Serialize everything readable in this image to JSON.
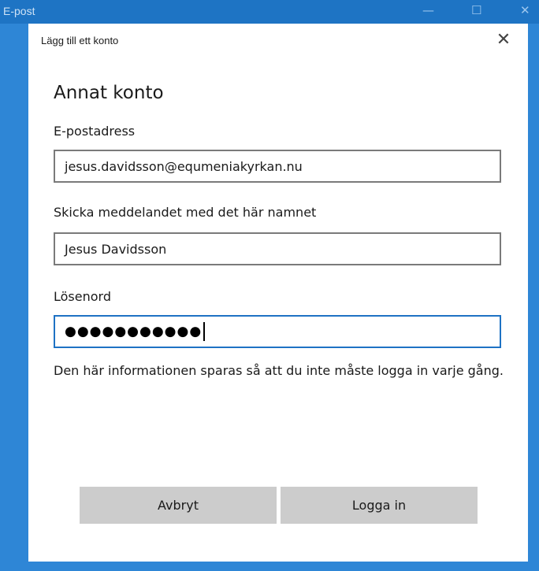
{
  "background_window": {
    "title": "E-post",
    "controls": {
      "minimize": "—",
      "maximize": "☐",
      "close": "✕"
    }
  },
  "dialog": {
    "title": "Lägg till ett konto",
    "close_icon": "✕",
    "heading": "Annat konto",
    "email": {
      "label": "E-postadress",
      "value": "jesus.davidsson@equmeniakyrkan.nu"
    },
    "name": {
      "label": "Skicka meddelandet med det här namnet",
      "value": "Jesus Davidsson"
    },
    "password": {
      "label": "Lösenord",
      "masked_value": "●●●●●●●●●●●"
    },
    "info_text": "Den här informationen sparas så att du inte måste logga in varje gång.",
    "buttons": {
      "cancel": "Avbryt",
      "login": "Logga in"
    }
  },
  "colors": {
    "accent": "#1e72c4",
    "titlebar": "#1e74c4",
    "button_bg": "#cccccc"
  }
}
